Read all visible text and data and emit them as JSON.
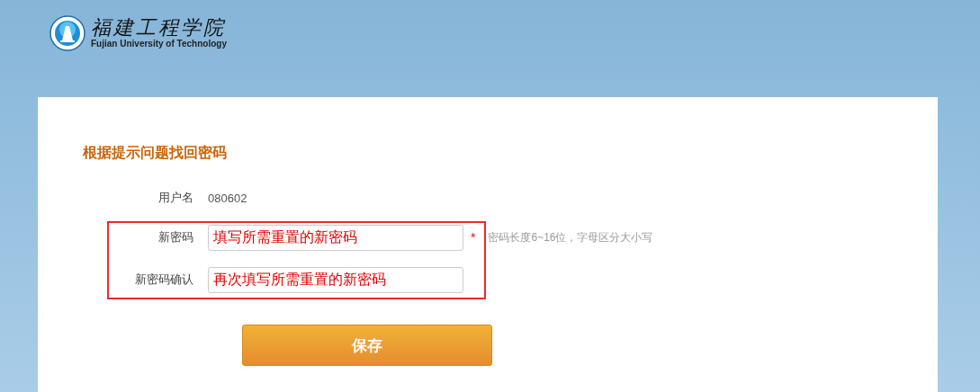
{
  "header": {
    "logo_name": "福建工程学院",
    "logo_subtitle": "Fujian University of Technology"
  },
  "form": {
    "title": "根据提示问题找回密码",
    "username": {
      "label": "用户名",
      "value": "080602"
    },
    "fields": [
      {
        "label": "新密码",
        "value": "填写所需重置的新密码",
        "required_mark": "*",
        "hint": "密码长度6~16位，字母区分大小写"
      },
      {
        "label": "新密码确认",
        "value": "再次填写所需重置的新密码"
      }
    ],
    "save_button": "保存"
  }
}
